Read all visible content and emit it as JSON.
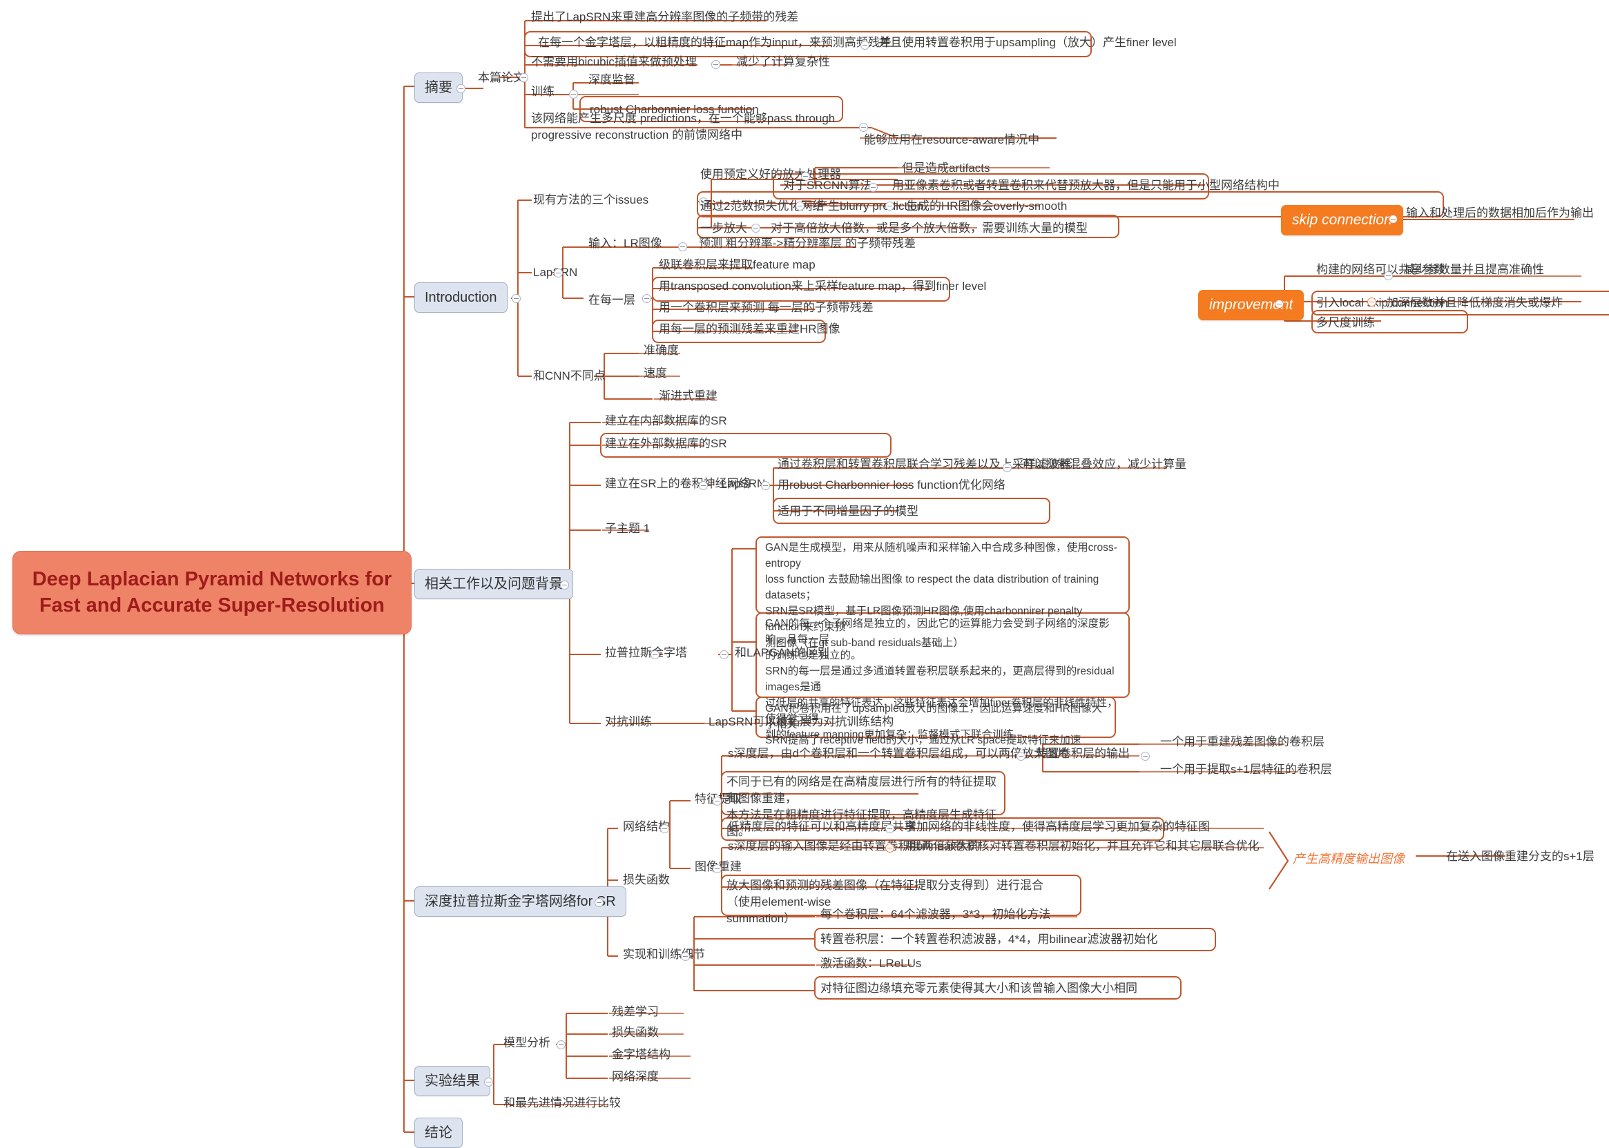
{
  "meta": {
    "title": "Deep Laplacian Pyramid Networks for Fast and Accurate Super-Resolution mind map",
    "accent_orange": "#c0572f",
    "root_fill": "#ef8367",
    "root_text": "#9e1b1b",
    "topic_box_fill": "#dde4ef",
    "pill_fill": "#f47b20",
    "text_color": "#3d3d3d"
  },
  "root": {
    "label": "Deep Laplacian Pyramid Networks for Fast and Accurate Super-Resolution"
  },
  "branches": {
    "abstract": {
      "label": "摘要"
    },
    "introduction": {
      "label": "Introduction"
    },
    "related": {
      "label": "相关工作以及问题背景"
    },
    "network": {
      "label": "深度拉普拉斯金字塔网络for SR"
    },
    "experiments": {
      "label": "实验结果"
    },
    "conclusion": {
      "label": "结论"
    }
  },
  "abstract": {
    "this_paper": "本篇论文",
    "items": [
      "提出了LapSRN来重建高分辨率图像的子频带的残差",
      "在每一个金字塔层，以粗精度的特征map作为input，来预测高频残差",
      "并且使用转置卷积用于upsampling（放大）产生finer level",
      "不需要用bicubic插值来做预处理",
      "减少了计算复杂性",
      "训练",
      "深度监督",
      "robust Charbonnier loss function",
      "该网络能产生多尺度 predictions，在一个能够pass through progressive reconstruction 的前馈网络中",
      "能够应用在resource-aware情况中"
    ]
  },
  "introduction": {
    "issues_label": "现有方法的三个issues",
    "issues": [
      "使用预定义好的放大处理器",
      "但是造成artifacts",
      "对于SRCNN算法",
      "用亚像素卷积或者转置卷积来代替预放大器，但是只能用于小型网络结构中",
      "通过2范数损失优化网络",
      "产生blurry prediction",
      "生成的HR图像会overly-smooth",
      "一步放大",
      "对于高倍放大倍数，或是多个放大倍数，需要训练大量的模型"
    ],
    "lapsrn_label": "LapSRN",
    "lapsrn": [
      "输入：LR图像",
      "预测 粗分辨率->精分辨率层 的子频带残差",
      "在每一层",
      "级联卷积层来提取feature map",
      "用transposed convolution来上采样feature map，得到finer level",
      "用一个卷积层来预测 每一层的子频带残差",
      "用每一层的预测残差来重建HR图像"
    ],
    "diff_cnn_label": "和CNN不同点",
    "diff_cnn": [
      "准确度",
      "速度",
      "渐进式重建"
    ]
  },
  "callouts": {
    "skip_connection": {
      "label": "skip connection",
      "detail": "输入和处理后的数据相加后作为输出"
    },
    "improvement": {
      "label": "improvement",
      "items": [
        "构建的网络可以共享参数",
        "减少参数量并且提高准确性",
        "引入local skip connection",
        "加深层数并且降低梯度消失或爆炸",
        "多尺度训练"
      ]
    },
    "output_arrow": {
      "label": "产生高精度输出图像",
      "detail": "在送入图像重建分支的s+1层"
    }
  },
  "related": {
    "items": [
      "建立在内部数据库的SR",
      "建立在外部数据库的SR",
      "建立在SR上的卷积神经网络",
      "LapSRN",
      "通过卷积层和转置卷积层联合学习残差以及上采样滤波器",
      "可以抑制混叠效应，减少计算量",
      "用robust Charbonnier loss function优化网络",
      "适用于不同增量因子的模型",
      "子主题 1"
    ],
    "laplacian_label": "拉普拉斯金字塔",
    "diff_lapgan_label": "和LAPGAN的区别",
    "lapgan_blocks": [
      "GAN是生成模型，用来从随机噪声和采样输入中合成多种图像，使用cross-entropy\nloss function 去鼓励输出图像 to respect the data distribution of training\ndatasets；\nSRN是SR模型，基于LR图像预测HR图像,使用charbonnirer penalty function来约束预\n测图像（在gt sub-band residuals基础上）",
      "GAN的每一个子网络是独立的，因此它的运算能力会受到子网络的深度影响，且每一层\n的训练也是独立的。\nSRN的每一层是通过多通道转置卷积层联系起来的，更高层得到的residual images是通\n过低层的共享的特征表达，这些特征表达会增加finer卷积层的非线性特性，使得学习得\n到的feature mapping更加复杂；监督模式下联合训练",
      "GAN把卷积用在了upsampled放大的图像上，因此运算速度和HR图像大小相关\nSRN提高了receptive field的大小，通过从LR space提取特征来加速"
    ],
    "adversarial_label": "对抗训练",
    "adversarial_detail": "LapSRN可以被拓展为对抗训练结构"
  },
  "network": {
    "structure_label": "网络结构",
    "feature_extraction_label": "特征提取",
    "feature_extraction": [
      "s深度层，由d个卷积层和一个转置卷积层组成，可以两倍放大图片",
      "转置卷积层的输出",
      "一个用于重建残差图像的卷积层",
      "一个用于提取s+1层特征的卷积层",
      "不同于已有的网络是在高精度层进行所有的特征提取和图像重建，\n本方法是在粗精度进行特征提取，高精度层生成特征图。",
      "低精度层的特征可以和高精度层共享",
      "增加网络的非线性度，使得高精度层学习更加复杂的特征图"
    ],
    "image_reconstruction_label": "图像重建",
    "image_reconstruction": [
      "s深度层的输入图像是经由转置卷积层两倍放大的",
      "用bilinear卷积核对转置卷积层初始化，并且允许它和其它层联合优化",
      "放大图像和预测的残差图像（在特征提取分支得到）进行混合（使用element-wise\nsummation）"
    ],
    "loss_label": "损失函数",
    "impl_label": "实现和训练细节",
    "impl": [
      "每个卷积层：64个滤波器，3*3，初始化方法",
      "转置卷积层：一个转置卷积滤波器，4*4，用bilinear滤波器初始化",
      "激活函数：LReLUs",
      "对特征图边缘填充零元素使得其大小和该曾输入图像大小相同"
    ]
  },
  "experiments": {
    "model_analysis_label": "模型分析",
    "model_analysis": [
      "残差学习",
      "损失函数",
      "金字塔结构",
      "网络深度"
    ],
    "comparison": "和最先进情况进行比较"
  }
}
